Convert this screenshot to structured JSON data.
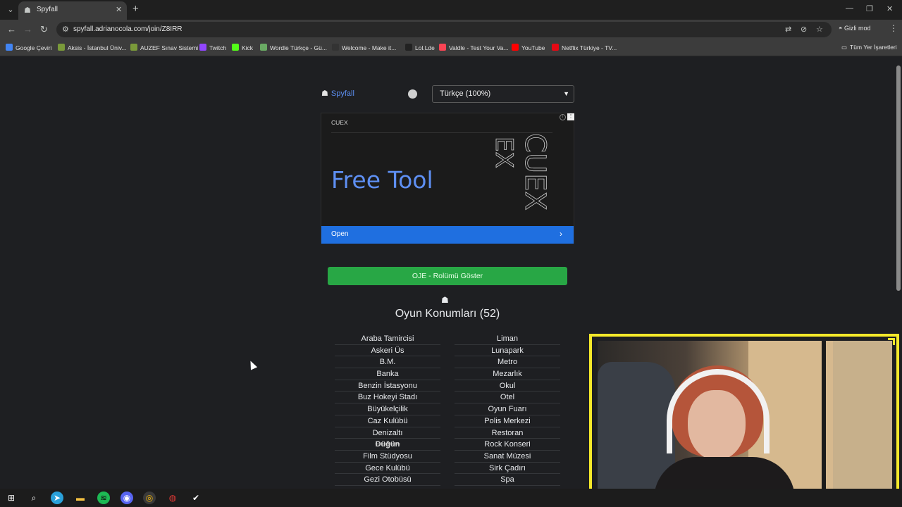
{
  "browser": {
    "tab": {
      "title": "Spyfall",
      "close": "✕"
    },
    "new_tab": "+",
    "window_controls": {
      "minimize": "—",
      "maximize": "❐",
      "close": "✕"
    },
    "nav": {
      "back": "←",
      "forward": "→",
      "reload": "↻"
    },
    "url": "spyfall.adrianocola.com/join/Z8IRR",
    "incognito_label": "Gizli mod",
    "bookmarks": [
      {
        "label": "Google Çeviri",
        "color": "#4285f4"
      },
      {
        "label": "Aksis - İstanbul Üniv...",
        "color": "#7a9a3a"
      },
      {
        "label": "AUZEF Sınav Sistemi",
        "color": "#7a9a3a"
      },
      {
        "label": "Twitch",
        "color": "#9146ff"
      },
      {
        "label": "Kick",
        "color": "#53fc18"
      },
      {
        "label": "Wordle Türkçe - Gü...",
        "color": "#6aaa64"
      },
      {
        "label": "Welcome - Make it...",
        "color": "#333333"
      },
      {
        "label": "Lol.Lde",
        "color": "#222222"
      },
      {
        "label": "Valdle - Test Your Va...",
        "color": "#fa4454"
      },
      {
        "label": "YouTube",
        "color": "#ff0000"
      },
      {
        "label": "Netflix Türkiye - TV...",
        "color": "#e50914"
      }
    ],
    "all_bookmarks": "Tüm Yer İşaretleri"
  },
  "header": {
    "brand": "Spyfall",
    "language": "Türkçe (100%)"
  },
  "ad": {
    "brand": "CUEX",
    "headline": "Free Tool",
    "cta": "Open",
    "deco_letters": [
      "EX",
      "CUEX"
    ]
  },
  "game": {
    "role_button": "OJE - Rolümü Göster",
    "locations_title": "Oyun Konumları (52)",
    "locations_left": [
      {
        "name": "Araba Tamircisi",
        "struck": false
      },
      {
        "name": "Askeri Üs",
        "struck": false
      },
      {
        "name": "B.M.",
        "struck": false
      },
      {
        "name": "Banka",
        "struck": false
      },
      {
        "name": "Benzin İstasyonu",
        "struck": false
      },
      {
        "name": "Buz Hokeyi Stadı",
        "struck": false
      },
      {
        "name": "Büyükelçilik",
        "struck": false
      },
      {
        "name": "Caz Kulübü",
        "struck": false
      },
      {
        "name": "Denizaltı",
        "struck": false
      },
      {
        "name": "Düğün",
        "struck": true
      },
      {
        "name": "Film Stüdyosu",
        "struck": false
      },
      {
        "name": "Gece Kulübü",
        "struck": false
      },
      {
        "name": "Gezi Otobüsü",
        "struck": false
      }
    ],
    "locations_right": [
      {
        "name": "Liman",
        "struck": false
      },
      {
        "name": "Lunapark",
        "struck": false
      },
      {
        "name": "Metro",
        "struck": false
      },
      {
        "name": "Mezarlık",
        "struck": false
      },
      {
        "name": "Okul",
        "struck": false
      },
      {
        "name": "Otel",
        "struck": false
      },
      {
        "name": "Oyun Fuarı",
        "struck": false
      },
      {
        "name": "Polis Merkezi",
        "struck": false
      },
      {
        "name": "Restoran",
        "struck": false
      },
      {
        "name": "Rock Konseri",
        "struck": false
      },
      {
        "name": "Sanat Müzesi",
        "struck": false
      },
      {
        "name": "Sirk Çadırı",
        "struck": false
      },
      {
        "name": "Spa",
        "struck": false
      }
    ]
  },
  "colors": {
    "accent_blue": "#5c8ef0",
    "role_button_green": "#28a745",
    "cam_frame_yellow": "#f5e92a",
    "ad_cta_blue": "#1f6fe0"
  }
}
